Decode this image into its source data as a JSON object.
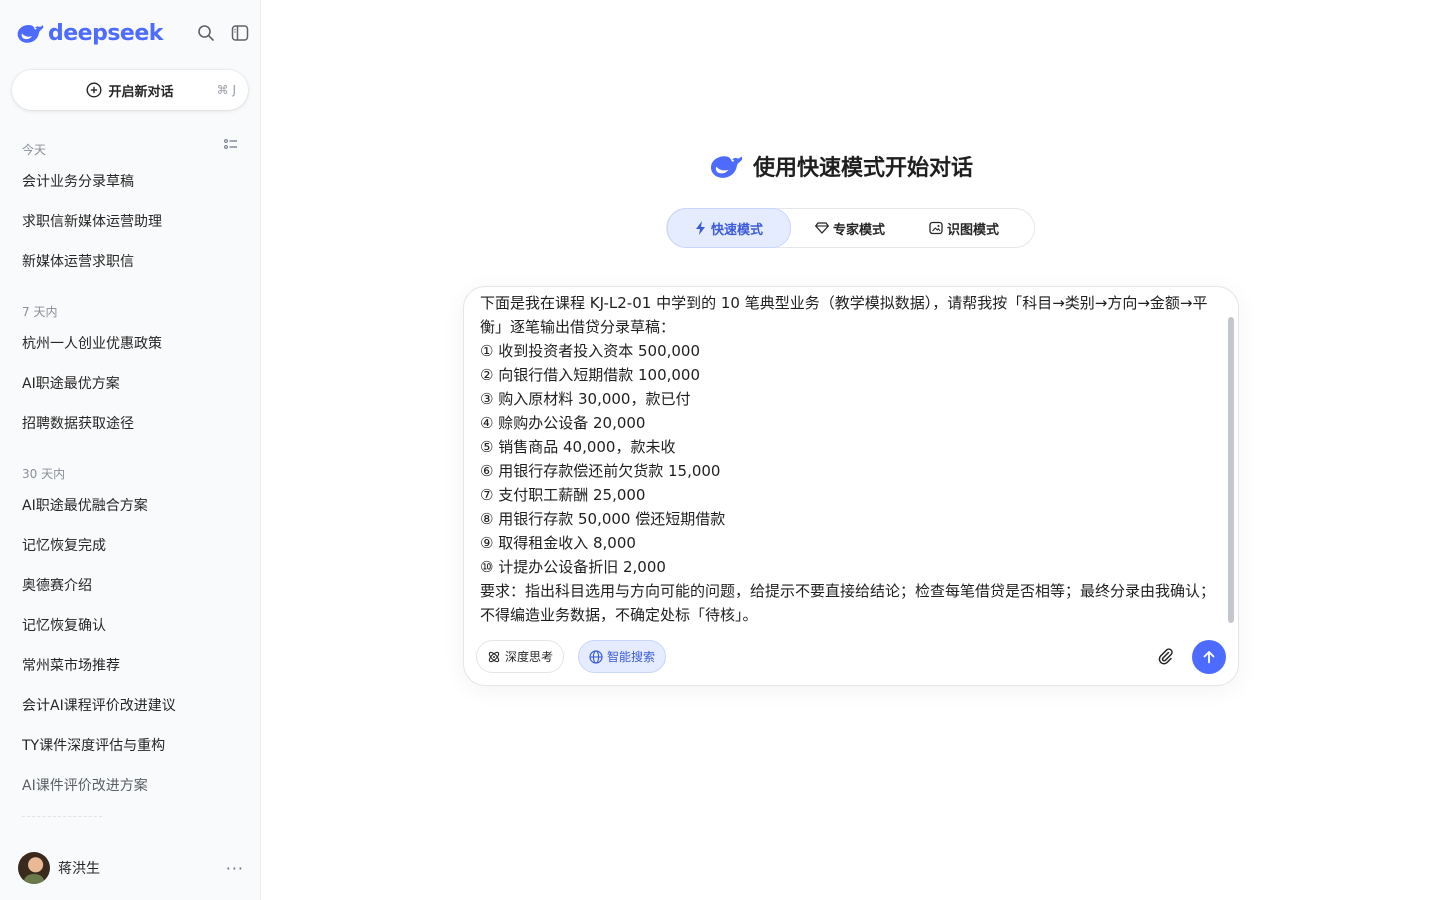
{
  "brand": {
    "name": "deepseek",
    "accent": "#4d6bfe"
  },
  "sidebar": {
    "new_chat_label": "开启新对话",
    "new_chat_shortcut": "⌘ J",
    "sections": [
      {
        "label": "今天",
        "items": [
          "会计业务分录草稿",
          "求职信新媒体运营助理",
          "新媒体运营求职信"
        ]
      },
      {
        "label": "7 天内",
        "items": [
          "杭州一人创业优惠政策",
          "AI职途最优方案",
          "招聘数据获取途径"
        ]
      },
      {
        "label": "30 天内",
        "items": [
          "AI职途最优融合方案",
          "记忆恢复完成",
          "奥德赛介绍",
          "记忆恢复确认",
          "常州菜市场推荐",
          "会计AI课程评价改进建议",
          "TY课件深度评估与重构",
          "AI课件评价改进方案"
        ]
      }
    ],
    "user": {
      "name": "蒋洪生"
    }
  },
  "main": {
    "headline": "使用快速模式开始对话",
    "modes": [
      {
        "label": "快速模式",
        "icon": "bolt-icon",
        "active": true
      },
      {
        "label": "专家模式",
        "icon": "diamond-icon",
        "active": false
      },
      {
        "label": "识图模式",
        "icon": "image-scan-icon",
        "active": false
      }
    ],
    "composer": {
      "text": "下面是我在课程 KJ-L2-01 中学到的 10 笔典型业务（教学模拟数据），请帮我按「科目→类别→方向→金额→平衡」逐笔输出借贷分录草稿：\n① 收到投资者投入资本 500,000\n② 向银行借入短期借款 100,000\n③ 购入原材料 30,000，款已付\n④ 赊购办公设备 20,000\n⑤ 销售商品 40,000，款未收\n⑥ 用银行存款偿还前欠货款 15,000\n⑦ 支付职工薪酬 25,000\n⑧ 用银行存款 50,000 偿还短期借款\n⑨ 取得租金收入 8,000\n⑩ 计提办公设备折旧 2,000\n要求：指出科目选用与方向可能的问题，给提示不要直接给结论；检查每笔借贷是否相等；最终分录由我确认；不得编造业务数据，不确定处标「待核」。",
      "deep_think_label": "深度思考",
      "web_search_label": "智能搜索"
    }
  }
}
